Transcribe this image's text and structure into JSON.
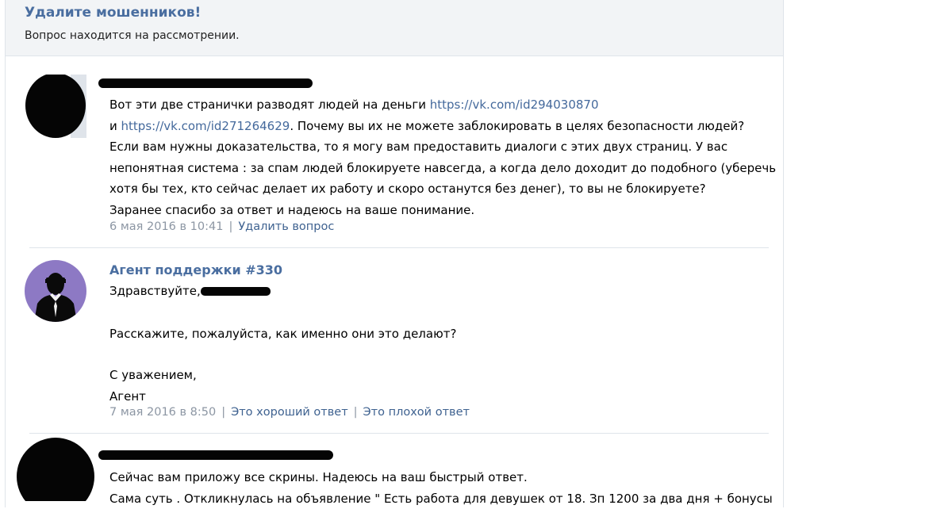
{
  "header": {
    "title": "Удалите мошенников!",
    "status": "Вопрос находится на рассмотрении."
  },
  "messages": [
    {
      "avatar_icon": "redacted-avatar",
      "author_redacted": true,
      "line1_text": "Вот эти две странички разводят людей на деньги ",
      "line1_link": "https://vk.com/id294030870",
      "line2_prefix": "и ",
      "line2_link": "https://vk.com/id271264629",
      "line2_text": ". Почему вы их не можете заблокировать в целях безопасности людей?",
      "line3": "Если вам нужны доказательства, то я могу вам предоставить диалоги с этих двух страниц. У вас",
      "line4": "непонятная система : за спам людей блокируете навсегда, а когда дело доходит до подобного (уберечь",
      "line5": "хотя бы тех, кто сейчас делает их работу и скоро останутся без денег), то вы не блокируете?",
      "line6": "Заранее спасибо за ответ и надеюсь на ваше понимание.",
      "date": "6 мая 2016 в 10:41",
      "action": "Удалить вопрос"
    },
    {
      "avatar_icon": "support-agent-avatar",
      "author": "Агент поддержки #330",
      "greeting": "Здравствуйте,",
      "body": "Расскажите, пожалуйста, как именно они это делают?",
      "sign1": "С уважением,",
      "sign2": "Агент",
      "date": "7 мая 2016 в 8:50",
      "good": "Это хороший ответ",
      "bad": "Это плохой ответ"
    },
    {
      "avatar_icon": "redacted-avatar",
      "author_redacted": true,
      "line1": "Сейчас вам приложу все скрины. Надеюсь на ваш быстрый ответ.",
      "line2": "Сама суть . Откликнулась на объявление \" Есть работа для девушек от 18. Зп 1200 за два дня + бонусы"
    }
  ],
  "colors": {
    "link": "#44699c",
    "title": "#4a6ea0",
    "meta": "#8c96a3",
    "agent_avatar_bg": "#8d79c4"
  }
}
